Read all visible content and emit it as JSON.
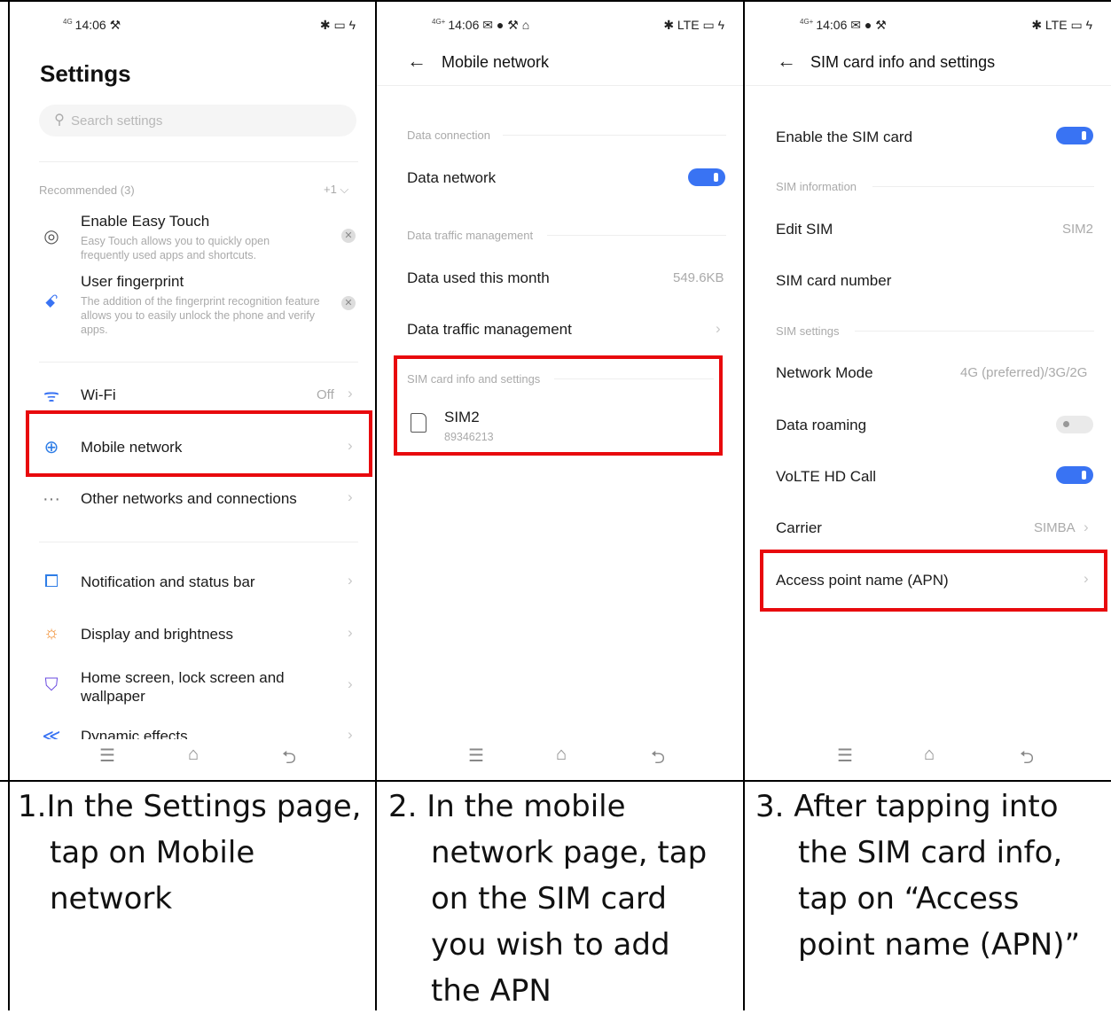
{
  "phone1": {
    "status_time": "14:06",
    "status_signal": "4G",
    "status_icons_left": "⚒",
    "status_icons_right": "✱ ▭ ϟ",
    "title": "Settings",
    "search_placeholder": "Search settings",
    "recommended_label": "Recommended (3)",
    "recommended_more": "+1 ⌵",
    "rec_items": [
      {
        "title": "Enable Easy Touch",
        "sub": "Easy Touch allows you to quickly open frequently used apps and shortcuts.",
        "icon": "target-icon"
      },
      {
        "title": "User fingerprint",
        "sub": "The addition of the fingerprint recognition feature allows you to easily unlock the phone and verify apps.",
        "icon": "fingerprint-icon"
      }
    ],
    "items": [
      {
        "label": "Wi-Fi",
        "value": "Off",
        "icon": "wifi-icon"
      },
      {
        "label": "Mobile network",
        "value": "",
        "icon": "globe-icon"
      },
      {
        "label": "Other networks and connections",
        "value": "",
        "icon": "more-dots-icon"
      },
      {
        "label": "Notification and status bar",
        "value": "",
        "icon": "notification-icon"
      },
      {
        "label": "Display and brightness",
        "value": "",
        "icon": "sun-icon"
      },
      {
        "label": "Home screen, lock screen and wallpaper",
        "value": "",
        "icon": "shirt-icon"
      },
      {
        "label": "Dynamic effects",
        "value": "",
        "icon": "effects-icon"
      }
    ]
  },
  "phone2": {
    "status_time": "14:06",
    "status_signal": "4G+",
    "status_icons_left": "✉ ● ⚒ ⌂",
    "status_icons_right": "✱ LTE ▭ ϟ",
    "title": "Mobile network",
    "sec_data_connection": "Data connection",
    "data_network": "Data network",
    "sec_traffic": "Data traffic management",
    "data_used_label": "Data used this month",
    "data_used_value": "549.6KB",
    "traffic_mgmt": "Data traffic management",
    "sec_sim": "SIM card info and settings",
    "sim_name": "SIM2",
    "sim_number": "89346213"
  },
  "phone3": {
    "status_time": "14:06",
    "status_signal": "4G+",
    "status_icons_left": "✉ ● ⚒",
    "status_icons_right": "✱ LTE ▭ ϟ",
    "title": "SIM card info and settings",
    "enable_sim": "Enable the SIM card",
    "sec_info": "SIM information",
    "edit_sim": "Edit SIM",
    "edit_sim_value": "SIM2",
    "sim_number": "SIM card number",
    "sec_settings": "SIM settings",
    "network_mode": "Network Mode",
    "network_mode_value": "4G (preferred)/3G/2G",
    "data_roaming": "Data roaming",
    "volte": "VoLTE HD Call",
    "carrier": "Carrier",
    "carrier_value": "SIMBA",
    "apn": "Access point name (APN)"
  },
  "nav": {
    "menu": "☰",
    "home": "⌂",
    "back": "⮌"
  },
  "captions": {
    "c1_l1": "1.In the Settings page,",
    "c1_l2": "tap on Mobile",
    "c1_l3": "network",
    "c2_l1": "2. In the mobile",
    "c2_l2": "network page, tap",
    "c2_l3": "on the SIM card",
    "c2_l4": "you wish to add",
    "c2_l5": "the APN",
    "c3_l1": "3. After tapping into",
    "c3_l2": "the SIM card info,",
    "c3_l3": "tap on “Access",
    "c3_l4": "point name (APN)”"
  },
  "colors": {
    "highlight": "#e8090d",
    "toggle_on": "#3973f3"
  }
}
